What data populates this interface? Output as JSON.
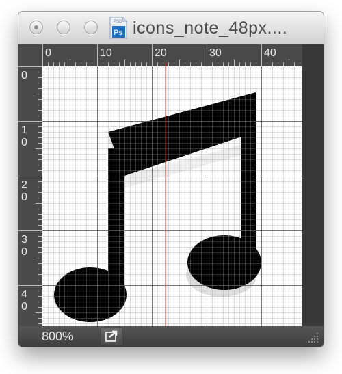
{
  "window": {
    "title": "icons_note_48px....",
    "app_icon_label": "Ps",
    "app_icon_sublabel": "PSD"
  },
  "rulers": {
    "top_labels": [
      "0",
      "10",
      "20",
      "30",
      "40"
    ],
    "left_labels": [
      [
        "0"
      ],
      [
        "1",
        "0"
      ],
      [
        "2",
        "0"
      ],
      [
        "3",
        "0"
      ],
      [
        "4",
        "0"
      ]
    ]
  },
  "status": {
    "zoom": "800%"
  },
  "colors": {
    "guide": "#e0262a",
    "ruler_bg": "#4a4a4a",
    "ruler_text": "#e8e8e8",
    "note_fill": "#000000"
  },
  "icons": {
    "traffic_close": "close-icon",
    "export": "share-icon",
    "resize": "resize-grip-icon"
  }
}
